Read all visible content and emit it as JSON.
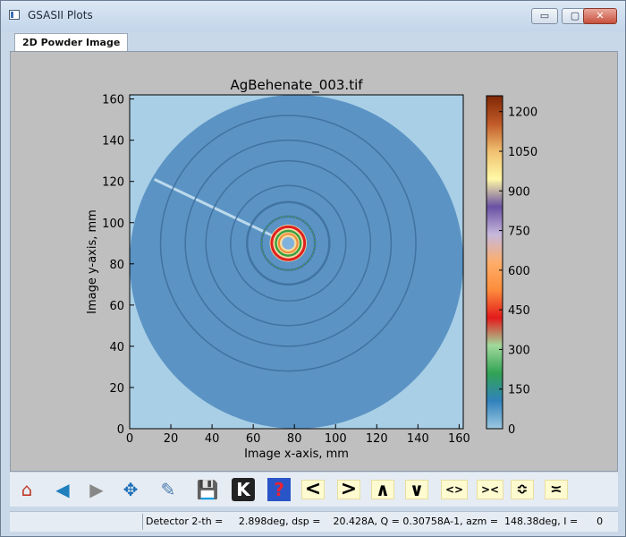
{
  "window": {
    "title": "GSASII Plots",
    "buttons": {
      "minimize": "▭",
      "maximize": "▢",
      "close": "✕"
    }
  },
  "tabs": [
    {
      "label": "2D Powder Image",
      "active": true
    }
  ],
  "chart_data": {
    "type": "heatmap",
    "title": "AgBehenate_003.tif",
    "xlabel": "Image x-axis, mm",
    "ylabel": "Image y-axis, mm",
    "xlim": [
      0,
      162
    ],
    "ylim": [
      0,
      162
    ],
    "xticks": [
      0,
      20,
      40,
      60,
      80,
      100,
      120,
      140,
      160
    ],
    "yticks": [
      0,
      20,
      40,
      60,
      80,
      100,
      120,
      140,
      160
    ],
    "beam_center": [
      77,
      90
    ],
    "detector_radius": 81,
    "ring_radii": [
      13,
      20,
      28,
      40,
      50,
      62
    ],
    "colorbar": {
      "range": [
        0,
        1260
      ],
      "ticks": [
        0,
        150,
        300,
        450,
        600,
        750,
        900,
        1050,
        1200
      ],
      "colors": [
        "#9ecae1",
        "#3182bd",
        "#31a354",
        "#a1d99b",
        "#e31a1c",
        "#fd8d3c",
        "#fdae6b",
        "#c6b8dc",
        "#6a51a3",
        "#fff9a6",
        "#f0c070",
        "#c05a28",
        "#7f2704"
      ]
    },
    "background_color": "#a9cfe6",
    "detector_color": "#5b94c4"
  },
  "toolbar": {
    "buttons": [
      {
        "name": "home-icon",
        "glyph": "⌂"
      },
      {
        "name": "back-icon",
        "glyph": "◀"
      },
      {
        "name": "forward-icon",
        "glyph": "▶"
      },
      {
        "name": "pan-icon",
        "glyph": "✥"
      },
      {
        "name": "zoom-icon",
        "glyph": "✎"
      },
      {
        "name": "save-icon",
        "glyph": "💾"
      },
      {
        "name": "k-icon",
        "glyph": "K"
      },
      {
        "name": "help-icon",
        "glyph": "?"
      }
    ],
    "keys": [
      "<",
      ">",
      "∧",
      "∨",
      "<>",
      "><",
      "≎",
      "≍"
    ]
  },
  "status": {
    "text": "Detector 2-th =     2.898deg, dsp =    20.428A, Q = 0.30758A-1, azm =  148.38deg, I =      0"
  }
}
